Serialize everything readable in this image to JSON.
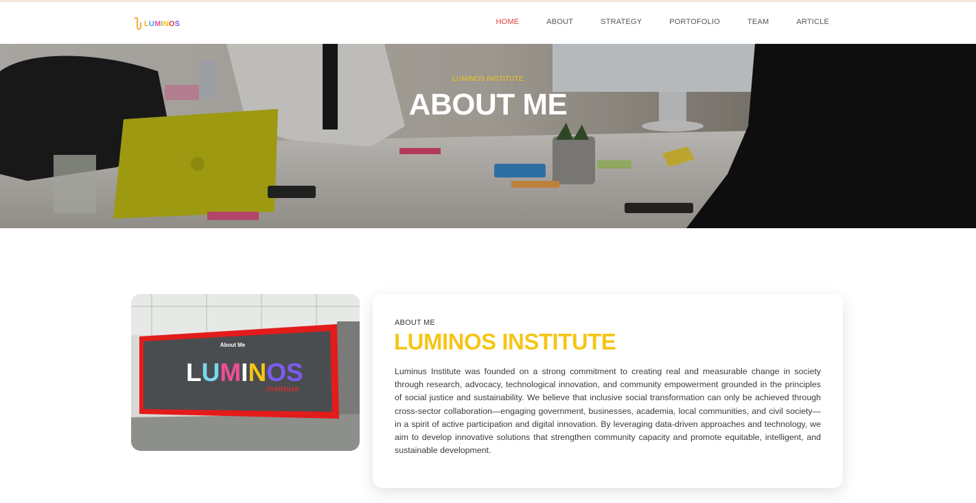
{
  "brand": {
    "logo_letters": [
      "L",
      "U",
      "M",
      "I",
      "N",
      "O",
      "S"
    ],
    "logo_colors": [
      "#f5a623",
      "#2bb3e8",
      "#f04e98",
      "#7ac943",
      "#f5c518",
      "#e23d3d",
      "#7b5cf0"
    ]
  },
  "nav": {
    "items": [
      {
        "label": "HOME",
        "active": true
      },
      {
        "label": "ABOUT",
        "active": false
      },
      {
        "label": "STRATEGY",
        "active": false
      },
      {
        "label": "PORTOFOLIO",
        "active": false
      },
      {
        "label": "TEAM",
        "active": false
      },
      {
        "label": "ARTICLE",
        "active": false
      }
    ]
  },
  "hero": {
    "kicker": "LUMINOS INSTITUTE",
    "title": "ABOUT ME"
  },
  "photo": {
    "sign_title": "About Me",
    "sign_logo": "LUMINOS",
    "sign_sub": "institute"
  },
  "about": {
    "kicker": "ABOUT ME",
    "title": "LUMINOS INSTITUTE",
    "body": "Luminus Institute was founded on a strong commitment to creating real and measurable change in society through research, advocacy, technological innovation, and community empowerment grounded in the principles of social justice and sustainability. We believe that inclusive social transformation can only be achieved through cross-sector collaboration—engaging government, businesses, academia, local communities, and civil society—in a spirit of active participation and digital innovation. By leveraging data-driven approaches and technology, we aim to develop innovative solutions that strengthen community capacity and promote equitable, intelligent, and sustainable development."
  },
  "colors": {
    "accent_yellow": "#f5c518",
    "nav_active_red": "#e23d3d"
  }
}
